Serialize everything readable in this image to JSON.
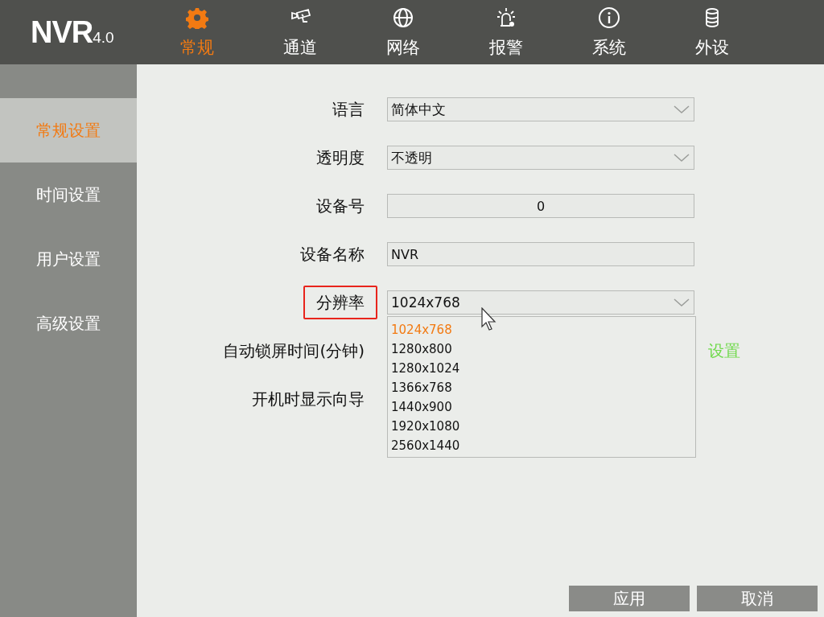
{
  "logo": {
    "name": "NVR",
    "version": "4.0"
  },
  "tabs": [
    {
      "label": "常规",
      "kind": "gear",
      "selected": true
    },
    {
      "label": "通道",
      "kind": "camera",
      "selected": false
    },
    {
      "label": "网络",
      "kind": "globe",
      "selected": false
    },
    {
      "label": "报警",
      "kind": "alarm",
      "selected": false
    },
    {
      "label": "系统",
      "kind": "info",
      "selected": false
    },
    {
      "label": "外设",
      "kind": "storage",
      "selected": false
    }
  ],
  "sidebar": {
    "items": [
      {
        "label": "常规设置",
        "selected": true
      },
      {
        "label": "时间设置",
        "selected": false
      },
      {
        "label": "用户设置",
        "selected": false
      },
      {
        "label": "高级设置",
        "selected": false
      }
    ]
  },
  "form": {
    "rows": [
      {
        "label": "语言",
        "kind": "select",
        "value": "简体中文",
        "highlighted": false
      },
      {
        "label": "透明度",
        "kind": "select",
        "value": "不透明",
        "highlighted": false
      },
      {
        "label": "设备号",
        "kind": "number",
        "value": "0",
        "highlighted": false
      },
      {
        "label": "设备名称",
        "kind": "text",
        "value": "NVR",
        "highlighted": false
      },
      {
        "label": "分辨率",
        "kind": "select",
        "value": "1024x768",
        "highlighted": true,
        "expanded": true,
        "options": [
          {
            "label": "1024x768",
            "selected": true
          },
          {
            "label": "1280x800",
            "selected": false
          },
          {
            "label": "1280x1024",
            "selected": false
          },
          {
            "label": "1366x768",
            "selected": false
          },
          {
            "label": "1440x900",
            "selected": false
          },
          {
            "label": "1920x1080",
            "selected": false
          },
          {
            "label": "2560x1440",
            "selected": false
          }
        ]
      },
      {
        "label": "自动锁屏时间(分钟)",
        "kind": "covered",
        "link": "设置",
        "highlighted": false
      },
      {
        "label": "开机时显示向导",
        "kind": "covered",
        "highlighted": false
      }
    ]
  },
  "buttons": [
    "应用",
    "取消"
  ]
}
